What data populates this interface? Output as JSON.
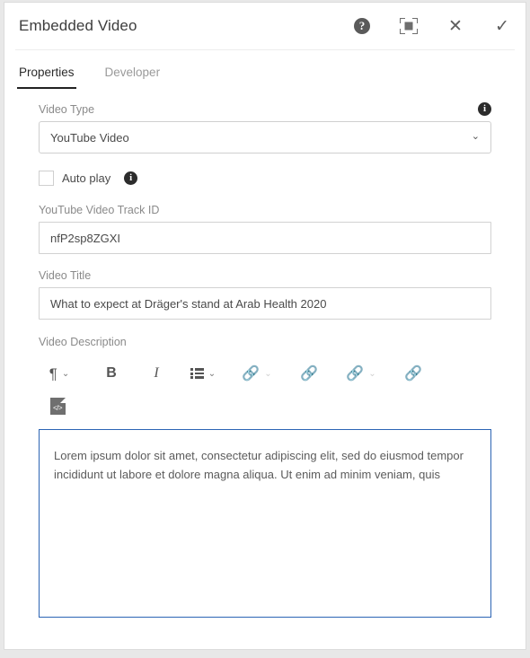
{
  "dialog": {
    "title": "Embedded Video",
    "actions": [
      {
        "name": "help-button",
        "icon": "help-circle-icon",
        "glyph": "?"
      },
      {
        "name": "maximize-button",
        "icon": "maximize-icon",
        "glyph": ""
      },
      {
        "name": "close-button",
        "icon": "close-icon",
        "glyph": "✕"
      },
      {
        "name": "confirm-button",
        "icon": "check-icon",
        "glyph": "✓"
      }
    ]
  },
  "tabs": [
    {
      "label": "Properties",
      "active": true
    },
    {
      "label": "Developer",
      "active": false
    }
  ],
  "form": {
    "video_type": {
      "label": "Video Type",
      "value": "YouTube Video",
      "info_glyph": "i",
      "chevron": "⌄"
    },
    "auto_play": {
      "label": "Auto play",
      "checked": false,
      "info_glyph": "i"
    },
    "track_id": {
      "label": "YouTube Video Track ID",
      "value": "nfP2sp8ZGXI"
    },
    "video_title": {
      "label": "Video Title",
      "value": "What to expect at Dräger's stand at Arab Health 2020"
    },
    "video_description": {
      "label": "Video Description",
      "value": "Lorem ipsum dolor sit amet, consectetur adipiscing elit, sed do eiusmod tempor incididunt ut labore et dolore magna aliqua. Ut enim ad minim veniam, quis"
    }
  },
  "editor_toolbar": {
    "paragraph": {
      "name": "paragraph-format-button",
      "glyph": "¶",
      "chevron": "⌄"
    },
    "bold": {
      "name": "bold-button",
      "glyph": "B"
    },
    "italic": {
      "name": "italic-button",
      "glyph": "I"
    },
    "list": {
      "name": "bullet-list-button",
      "chevron": "⌄"
    },
    "insert_link": {
      "name": "insert-link-button",
      "glyph": "🔗",
      "chevron": "⌄",
      "disabled": true
    },
    "unlink": {
      "name": "unlink-button",
      "glyph": "🔗",
      "disabled": true
    },
    "anchor_link": {
      "name": "anchor-link-button",
      "glyph": "🔗",
      "chevron": "⌄",
      "disabled": true
    },
    "remove_anchor": {
      "name": "remove-anchor-button",
      "glyph": "🔗",
      "disabled": true
    },
    "source_code": {
      "name": "source-code-button",
      "glyph": "</>"
    }
  },
  "colors": {
    "focus_border": "#2c64b4",
    "active_tab": "#222222",
    "page_background": "#e8e8e8"
  }
}
